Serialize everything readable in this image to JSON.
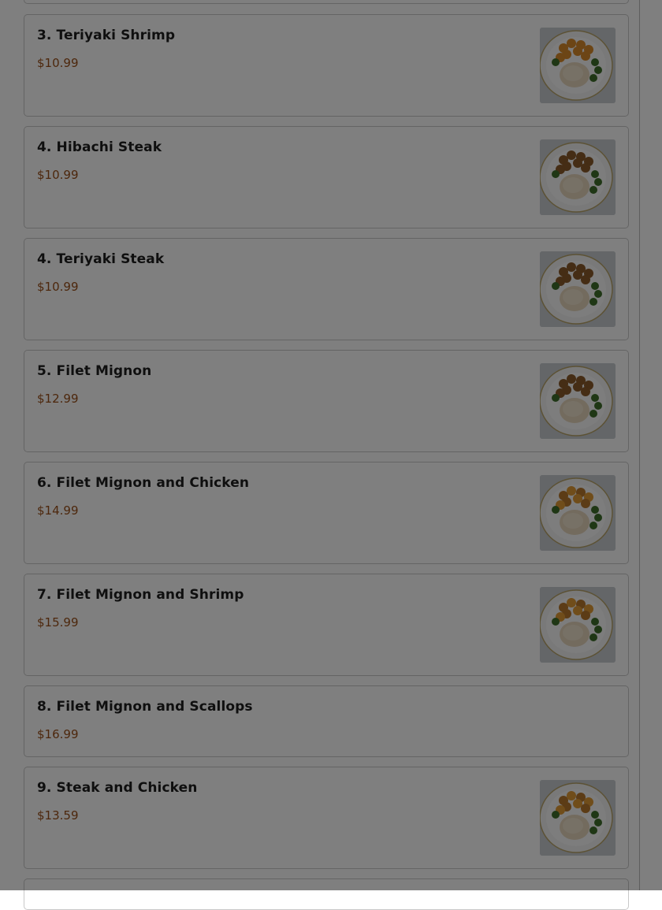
{
  "menu": {
    "items": [
      {
        "name": "",
        "price": "",
        "has_image": false
      },
      {
        "name": "3. Teriyaki Shrimp",
        "price": "$10.99",
        "has_image": true,
        "plate": "shrimp"
      },
      {
        "name": "4. Hibachi Steak",
        "price": "$10.99",
        "has_image": true,
        "plate": "steak"
      },
      {
        "name": "4. Teriyaki Steak",
        "price": "$10.99",
        "has_image": true,
        "plate": "steak"
      },
      {
        "name": "5. Filet Mignon",
        "price": "$12.99",
        "has_image": true,
        "plate": "steak"
      },
      {
        "name": "6. Filet Mignon and Chicken",
        "price": "$14.99",
        "has_image": true,
        "plate": "combo"
      },
      {
        "name": "7. Filet Mignon and Shrimp",
        "price": "$15.99",
        "has_image": true,
        "plate": "combo"
      },
      {
        "name": "8. Filet Mignon and Scallops",
        "price": "$16.99",
        "has_image": false
      },
      {
        "name": "9. Steak and Chicken",
        "price": "$13.59",
        "has_image": true,
        "plate": "combo"
      },
      {
        "name": "",
        "price": "",
        "has_image": false
      }
    ]
  },
  "colors": {
    "price": "#9a4f18",
    "overlay": "rgba(0,0,0,0.5)"
  }
}
